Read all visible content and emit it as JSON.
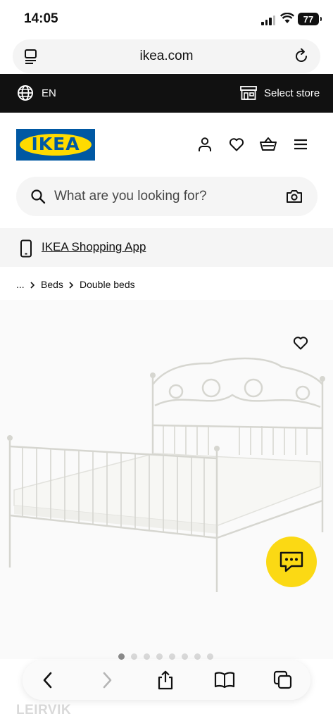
{
  "status_bar": {
    "time": "14:05",
    "battery": "77"
  },
  "browser": {
    "url": "ikea.com"
  },
  "topbar": {
    "language": "EN",
    "store_label": "Select store"
  },
  "brand": {
    "logo_text": "IKEA",
    "blue": "#0058a3",
    "yellow": "#ffdb00"
  },
  "header_icons": [
    "profile-icon",
    "heart-icon",
    "basket-icon",
    "menu-icon"
  ],
  "search": {
    "placeholder": "What are you looking for?"
  },
  "app_banner": {
    "label": "IKEA Shopping App"
  },
  "breadcrumb": {
    "ellipsis": "...",
    "items": [
      "Beds",
      "Double beds"
    ]
  },
  "carousel": {
    "total": 8,
    "active_index": 0
  },
  "product": {
    "name": "LEIRVIK"
  },
  "chat": {
    "color": "#fbd914"
  }
}
